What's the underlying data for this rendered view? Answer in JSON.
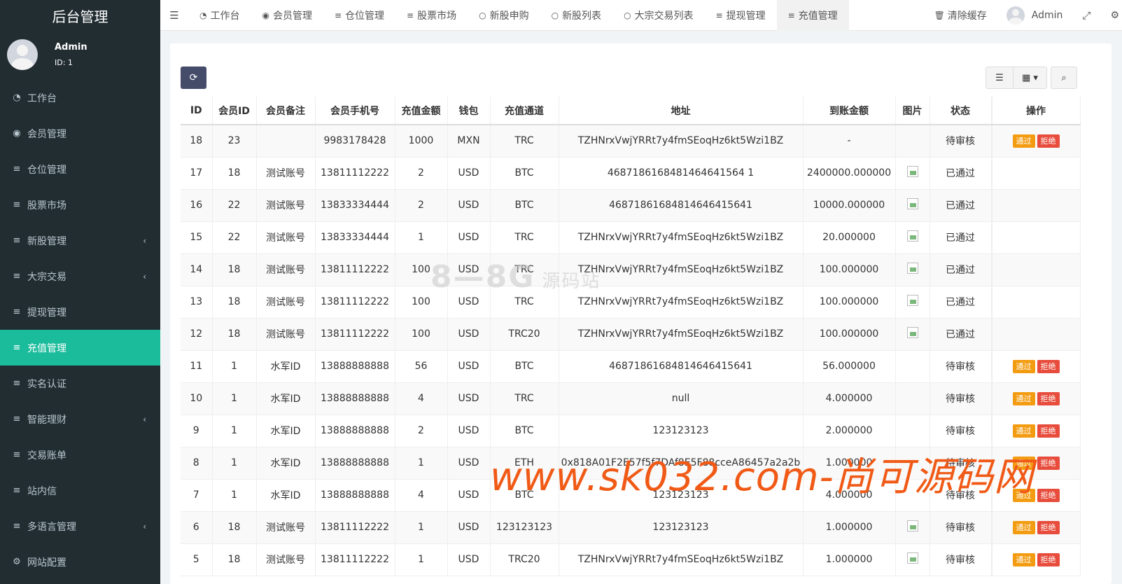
{
  "brand": "后台管理",
  "user": {
    "name": "Admin",
    "id_label": "ID: 1"
  },
  "sidebar": {
    "items": [
      {
        "label": "工作台",
        "icon": "dashboard-icon"
      },
      {
        "label": "会员管理",
        "icon": "user-circle-icon"
      },
      {
        "label": "仓位管理",
        "icon": "list-icon"
      },
      {
        "label": "股票市场",
        "icon": "list-icon"
      },
      {
        "label": "新股管理",
        "icon": "list-icon",
        "has_children": true
      },
      {
        "label": "大宗交易",
        "icon": "list-icon",
        "has_children": true
      },
      {
        "label": "提现管理",
        "icon": "list-icon"
      },
      {
        "label": "充值管理",
        "icon": "list-icon",
        "active": true
      },
      {
        "label": "实名认证",
        "icon": "list-icon"
      },
      {
        "label": "智能理财",
        "icon": "list-icon",
        "has_children": true
      },
      {
        "label": "交易账单",
        "icon": "list-icon"
      },
      {
        "label": "站内信",
        "icon": "list-icon"
      },
      {
        "label": "多语言管理",
        "icon": "list-icon",
        "has_children": true
      },
      {
        "label": "网站配置",
        "icon": "gear-icon"
      }
    ]
  },
  "topnav": {
    "tabs": [
      {
        "label": "工作台",
        "icon": "dashboard-icon"
      },
      {
        "label": "会员管理",
        "icon": "user-circle-icon"
      },
      {
        "label": "仓位管理",
        "icon": "list-icon"
      },
      {
        "label": "股票市场",
        "icon": "list-icon"
      },
      {
        "label": "新股申购",
        "icon": "circle-icon"
      },
      {
        "label": "新股列表",
        "icon": "circle-icon"
      },
      {
        "label": "大宗交易列表",
        "icon": "circle-icon"
      },
      {
        "label": "提现管理",
        "icon": "list-icon"
      },
      {
        "label": "充值管理",
        "icon": "list-icon",
        "active": true
      }
    ],
    "clear_cache": "清除缓存",
    "admin_name": "Admin"
  },
  "table": {
    "columns": [
      "ID",
      "会员ID",
      "会员备注",
      "会员手机号",
      "充值金额",
      "钱包",
      "充值通道",
      "地址",
      "到账金额",
      "图片",
      "状态",
      "操",
      "操作"
    ],
    "approve_label": "通过",
    "reject_label": "拒绝",
    "rows": [
      {
        "id": "18",
        "member_id": "23",
        "remark": "",
        "phone": "9983178428",
        "amount": "1000",
        "wallet": "MXN",
        "channel": "TRC",
        "address": "TZHNrxVwjYRRt7y4fmSEoqHz6kt5Wzi1BZ",
        "received": "-",
        "image": false,
        "status": "待审核",
        "actions": true
      },
      {
        "id": "17",
        "member_id": "18",
        "remark": "测试账号",
        "phone": "13811112222",
        "amount": "2",
        "wallet": "USD",
        "channel": "BTC",
        "address": "4687186168481464641564 1",
        "received": "2400000.000000",
        "image": true,
        "status": "已通过",
        "actions": false
      },
      {
        "id": "16",
        "member_id": "22",
        "remark": "测试账号",
        "phone": "13833334444",
        "amount": "2",
        "wallet": "USD",
        "channel": "BTC",
        "address": "46871861684814646415641",
        "received": "10000.000000",
        "image": true,
        "status": "已通过",
        "actions": false
      },
      {
        "id": "15",
        "member_id": "22",
        "remark": "测试账号",
        "phone": "13833334444",
        "amount": "1",
        "wallet": "USD",
        "channel": "TRC",
        "address": "TZHNrxVwjYRRt7y4fmSEoqHz6kt5Wzi1BZ",
        "received": "20.000000",
        "image": true,
        "status": "已通过",
        "actions": false
      },
      {
        "id": "14",
        "member_id": "18",
        "remark": "测试账号",
        "phone": "13811112222",
        "amount": "100",
        "wallet": "USD",
        "channel": "TRC",
        "address": "TZHNrxVwjYRRt7y4fmSEoqHz6kt5Wzi1BZ",
        "received": "100.000000",
        "image": true,
        "status": "已通过",
        "actions": false
      },
      {
        "id": "13",
        "member_id": "18",
        "remark": "测试账号",
        "phone": "13811112222",
        "amount": "100",
        "wallet": "USD",
        "channel": "TRC",
        "address": "TZHNrxVwjYRRt7y4fmSEoqHz6kt5Wzi1BZ",
        "received": "100.000000",
        "image": true,
        "status": "已通过",
        "actions": false
      },
      {
        "id": "12",
        "member_id": "18",
        "remark": "测试账号",
        "phone": "13811112222",
        "amount": "100",
        "wallet": "USD",
        "channel": "TRC20",
        "address": "TZHNrxVwjYRRt7y4fmSEoqHz6kt5Wzi1BZ",
        "received": "100.000000",
        "image": true,
        "status": "已通过",
        "actions": false
      },
      {
        "id": "11",
        "member_id": "1",
        "remark": "水军ID",
        "phone": "13888888888",
        "amount": "56",
        "wallet": "USD",
        "channel": "BTC",
        "address": "46871861684814646415641",
        "received": "56.000000",
        "image": false,
        "status": "待审核",
        "actions": true
      },
      {
        "id": "10",
        "member_id": "1",
        "remark": "水军ID",
        "phone": "13888888888",
        "amount": "4",
        "wallet": "USD",
        "channel": "TRC",
        "address": "null",
        "received": "4.000000",
        "image": false,
        "status": "待审核",
        "actions": true
      },
      {
        "id": "9",
        "member_id": "1",
        "remark": "水军ID",
        "phone": "13888888888",
        "amount": "2",
        "wallet": "USD",
        "channel": "BTC",
        "address": "123123123",
        "received": "2.000000",
        "image": false,
        "status": "待审核",
        "actions": true
      },
      {
        "id": "8",
        "member_id": "1",
        "remark": "水军ID",
        "phone": "13888888888",
        "amount": "1",
        "wallet": "USD",
        "channel": "ETH",
        "address": "0x818A01F2E57f5f7DAf8E5F88cceA86457a2a2b",
        "received": "1.000000",
        "image": false,
        "status": "待审核",
        "actions": true
      },
      {
        "id": "7",
        "member_id": "1",
        "remark": "水军ID",
        "phone": "13888888888",
        "amount": "4",
        "wallet": "USD",
        "channel": "BTC",
        "address": "123123123",
        "received": "4.000000",
        "image": false,
        "status": "待审核",
        "actions": true
      },
      {
        "id": "6",
        "member_id": "18",
        "remark": "测试账号",
        "phone": "13811112222",
        "amount": "1",
        "wallet": "USD",
        "channel": "123123123",
        "address": "123123123",
        "received": "1.000000",
        "image": true,
        "status": "待审核",
        "actions": true
      },
      {
        "id": "5",
        "member_id": "18",
        "remark": "测试账号",
        "phone": "13811112222",
        "amount": "1",
        "wallet": "USD",
        "channel": "TRC20",
        "address": "TZHNrxVwjYRRt7y4fmSEoqHz6kt5Wzi1BZ",
        "received": "1.000000",
        "image": true,
        "status": "待审核",
        "actions": true
      }
    ]
  },
  "watermarks": {
    "center": "8—8G",
    "center_sub": "源码站",
    "bottom": "www.sk032.com-尚可源码网"
  }
}
